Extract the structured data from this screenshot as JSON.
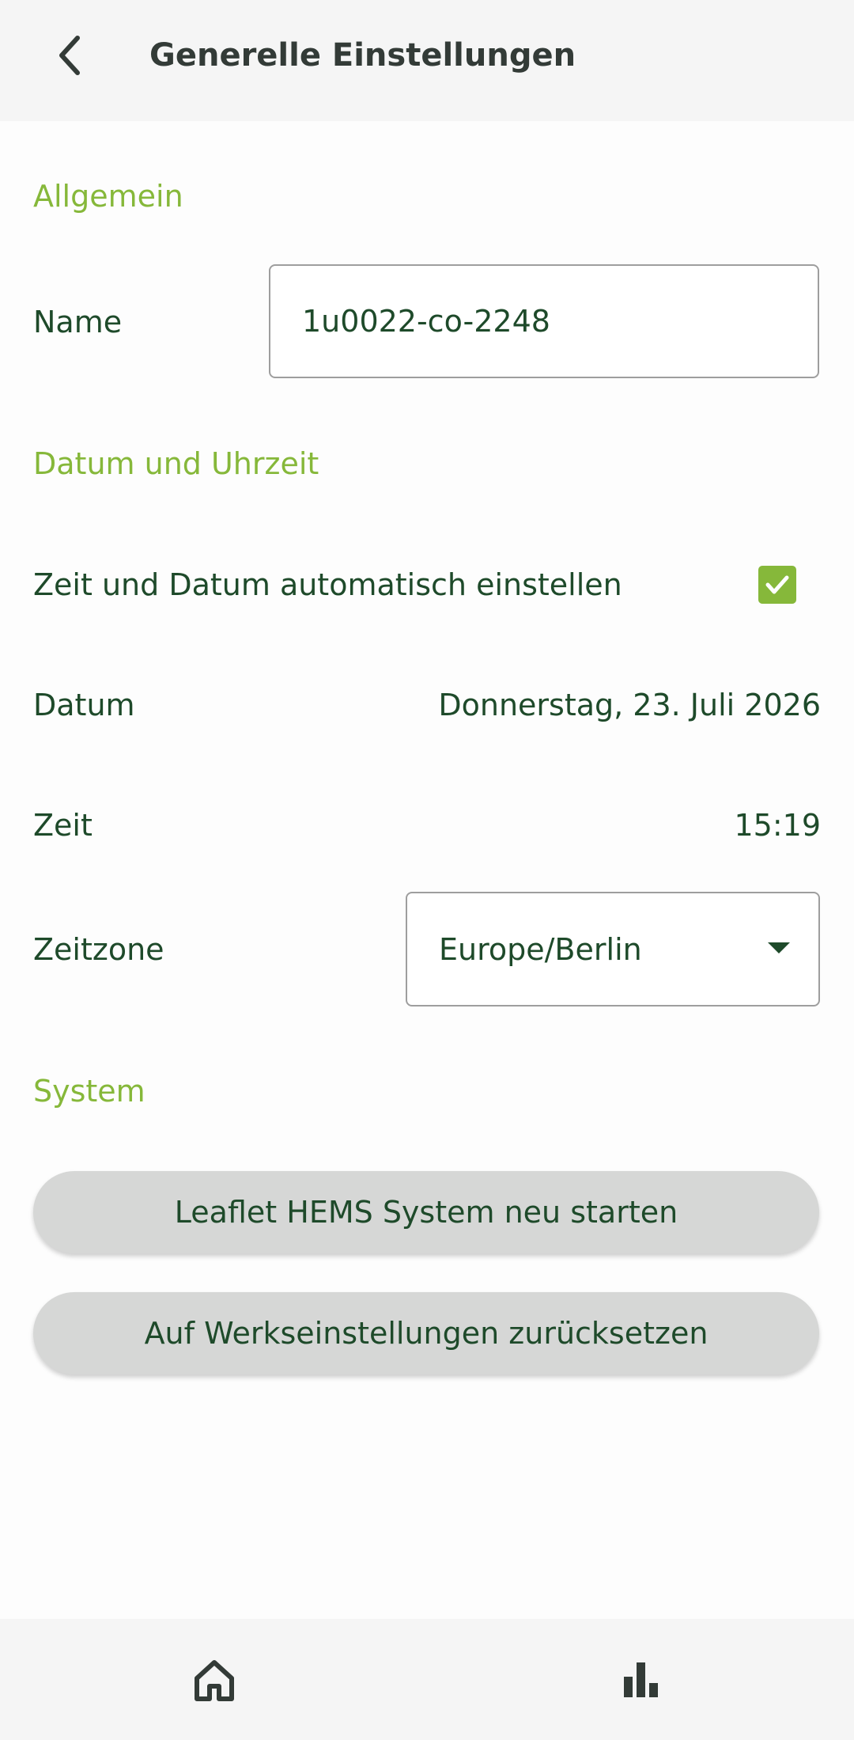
{
  "header": {
    "title": "Generelle Einstellungen"
  },
  "general": {
    "section_title": "Allgemein",
    "name_label": "Name",
    "name_value": "1u0022-co-2248"
  },
  "datetime": {
    "section_title": "Datum und Uhrzeit",
    "auto_label": "Zeit und Datum automatisch einstellen",
    "auto_checked": true,
    "date_label": "Datum",
    "date_value": "Donnerstag, 23. Juli 2026",
    "time_label": "Zeit",
    "time_value": "15:19",
    "timezone_label": "Zeitzone",
    "timezone_value": "Europe/Berlin"
  },
  "system": {
    "section_title": "System",
    "restart_label": "Leaflet HEMS System neu starten",
    "reset_label": "Auf Werkseinstellungen zurücksetzen"
  },
  "icons": {
    "back": "chevron-left-icon",
    "checkbox": "checkmark-icon",
    "dropdown": "caret-down-icon",
    "home": "home-icon",
    "chart": "bar-chart-icon"
  },
  "colors": {
    "accent": "#86b83a",
    "text": "#1e4a2a",
    "button_bg": "#d6d7d6",
    "header_bg": "#f5f5f5"
  }
}
